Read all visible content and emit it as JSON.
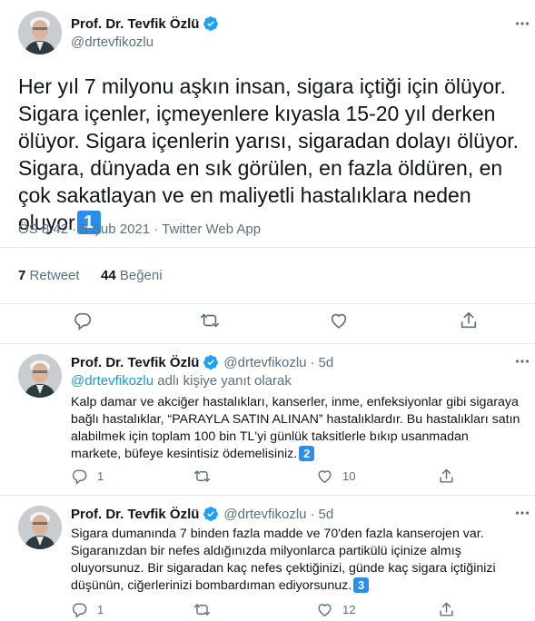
{
  "main_tweet": {
    "name": "Prof. Dr. Tevfik Özlü",
    "handle": "@drtevfikozlu",
    "body_text": "Her yıl 7 milyonu aşkın insan, sigara içtiği için ölüyor. Sigara içenler, içmeyenlere kıyasla 15-20 yıl derken ölüyor. Sigara içenlerin yarısı, sigaradan dolayı ölüyor. Sigara, dünyada en sık görülen, en fazla öldüren, en çok sakatlayan ve en maliyetli hastalıklara neden oluyor",
    "badge": "1",
    "meta": "ÖS 8:42 · 8 Şub 2021 · Twitter Web App",
    "retweet_count": "7",
    "retweet_label": "Retweet",
    "like_count": "44",
    "like_label": "Beğeni"
  },
  "replies": [
    {
      "name": "Prof. Dr. Tevfik Özlü",
      "handle": "@drtevfikozlu",
      "separator": "·",
      "time": "5d",
      "reply_to_handle": "@drtevfikozlu",
      "reply_to_suffix": " adlı kişiye yanıt olarak",
      "body_text": "Kalp damar ve akciğer hastalıkları, kanserler, inme, enfeksiyonlar gibi sigaraya bağlı hastalıklar, “PARAYLA SATIN ALINAN” hastalıklardır. Bu hastalıkları satın alabilmek için toplam 100 bin TL'yi günlük taksitlerle bıkıp usanmadan markete, büfeye kesintisiz ödemelisiniz.",
      "badge": "2",
      "reply_count": "1",
      "retweet_count": "",
      "like_count": "10"
    },
    {
      "name": "Prof. Dr. Tevfik Özlü",
      "handle": "@drtevfikozlu",
      "separator": "·",
      "time": "5d",
      "body_text": "Sigara dumanında 7 binden fazla madde ve 70'den fazla kanserojen var. Sigaranızdan bir nefes aldığınızda milyonlarca partikülü içinize almış oluyorsunuz. Bir sigaradan kaç nefes çektiğinizi, günde kaç sigara içtiğinizi düşünün, ciğerlerinizi bombardıman ediyorsunuz.",
      "badge": "3",
      "reply_count": "1",
      "retweet_count": "",
      "like_count": "12"
    }
  ],
  "icons": {
    "verified": "verified-badge-icon",
    "more": "more-icon",
    "reply": "reply-icon",
    "retweet": "retweet-icon",
    "like": "like-icon",
    "share": "share-icon"
  },
  "colors": {
    "verified_blue": "#1da1f2",
    "link_blue": "#1b95e0",
    "badge_blue": "#2a8ef0",
    "secondary_text": "#5b7083",
    "divider": "#e6ecf0"
  }
}
